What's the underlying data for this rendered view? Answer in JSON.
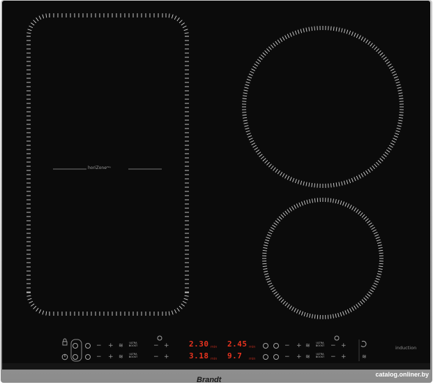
{
  "brand": "Brandt",
  "zone_label": "horiZone",
  "zone_label_sup": "Play",
  "feature_label": "induction",
  "timers": [
    {
      "value": "2.30",
      "unit": "min"
    },
    {
      "value": "2.45",
      "unit": "min"
    },
    {
      "value": "3.18",
      "unit": "min"
    },
    {
      "value": "9.7",
      "unit": "min"
    }
  ],
  "boost_label": "ULTRA BOOST",
  "watermark": "catalog.onliner.by",
  "colors": {
    "glass": "#0c0c0c",
    "frame": "#a9a9a9",
    "display": "#e8331f",
    "marks": "#d8d8d8"
  },
  "icons": [
    "lock-icon",
    "power-icon",
    "timer-icon",
    "keep-warm-icon",
    "bridge-icon",
    "plus-icon",
    "minus-icon",
    "zone-select-icon"
  ]
}
